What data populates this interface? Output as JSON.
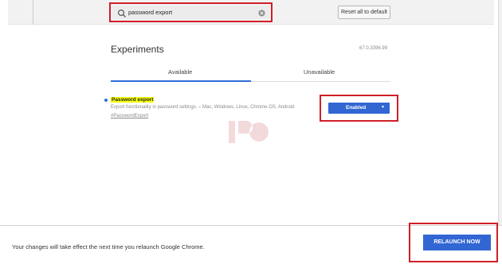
{
  "header": {
    "search": {
      "value": "password export"
    },
    "reset_label": "Reset all to default"
  },
  "main": {
    "title": "Experiments",
    "version": "67.0.3396.99",
    "tabs": [
      {
        "label": "Available",
        "active": true
      },
      {
        "label": "Unavailable",
        "active": false
      }
    ]
  },
  "experiment": {
    "name": "Password export",
    "description": "Export functionality in password settings. – Mac, Windows, Linux, Chrome OS, Android",
    "link": "#PasswordExport",
    "state": "Enabled"
  },
  "footer": {
    "message": "Your changes will take effect the next time you relaunch Google Chrome.",
    "relaunch_label": "RELAUNCH NOW"
  },
  "colors": {
    "accent": "#3266d3",
    "highlight": "#f4ff0b",
    "annotation": "#d01f2a"
  }
}
